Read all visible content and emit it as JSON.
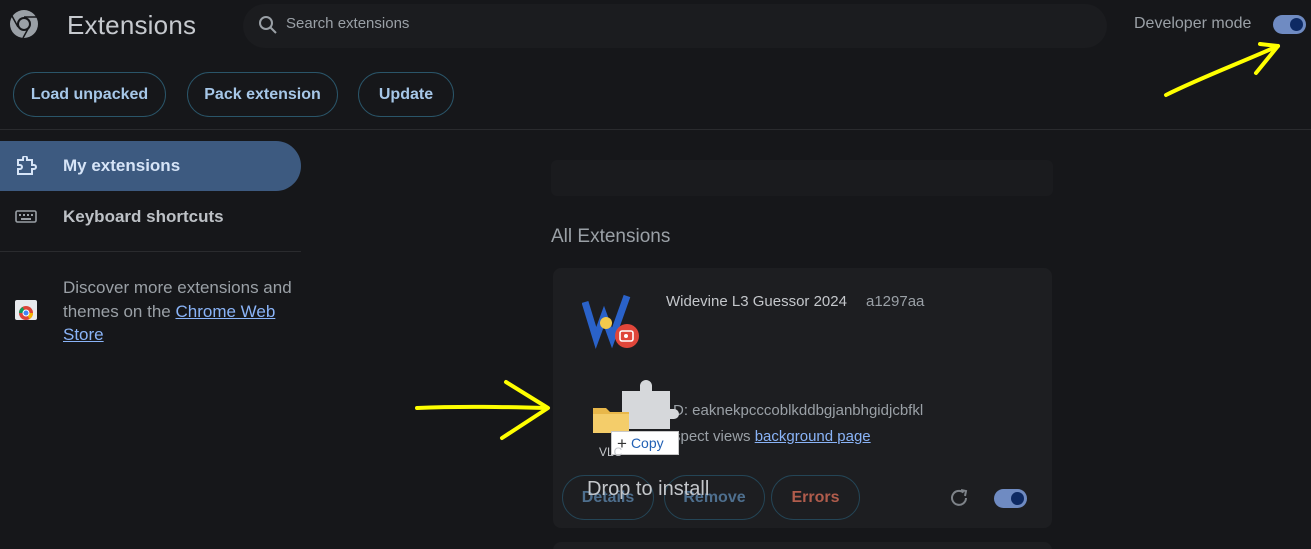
{
  "header": {
    "title": "Extensions",
    "search_placeholder": "Search extensions",
    "developer_mode_label": "Developer mode",
    "developer_mode_on": true
  },
  "toolbar": {
    "load_unpacked": "Load unpacked",
    "pack_extension": "Pack extension",
    "update": "Update"
  },
  "sidebar": {
    "items": [
      {
        "label": "My extensions",
        "icon": "puzzle-icon",
        "active": true
      },
      {
        "label": "Keyboard shortcuts",
        "icon": "keyboard-icon",
        "active": false
      }
    ],
    "discover_text": "Discover more extensions and themes on the",
    "discover_link": "Chrome Web Store"
  },
  "main": {
    "section_title": "All Extensions",
    "extension": {
      "name": "Widevine L3 Guessor 2024",
      "version": "a1297aa",
      "id_text": "D: eaknekpcccoblkddbgjanbhgidjcbfkl",
      "inspect_text": "spect views",
      "inspect_link": "background page",
      "details": "Details",
      "remove": "Remove",
      "errors": "Errors",
      "enabled": true
    },
    "drop_text": "Drop to install"
  },
  "drag_overlay": {
    "copy_label": "Copy",
    "file_label": "VLC"
  },
  "colors": {
    "background": "#16171a",
    "accent": "#8ab4f8",
    "toggle_on": "#6f8bc2",
    "annotation": "#ffff00"
  }
}
